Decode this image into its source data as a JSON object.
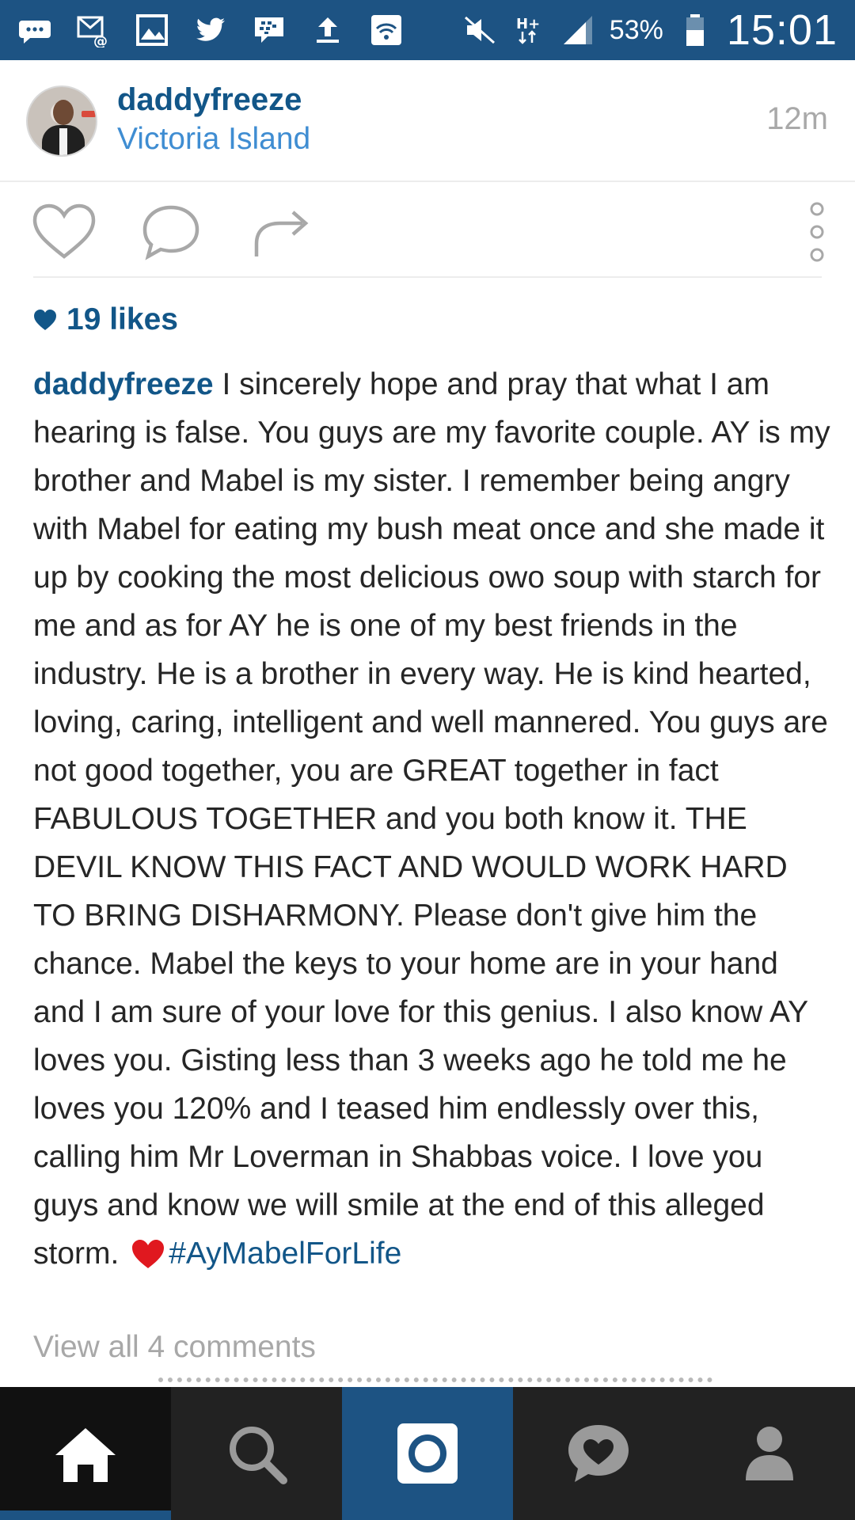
{
  "status_bar": {
    "battery_percent": "53%",
    "time": "15:01",
    "icons": [
      "message-icon",
      "email-icon",
      "gallery-icon",
      "twitter-icon",
      "bbm-icon",
      "upload-icon",
      "wifi-icon",
      "mute-icon",
      "network-hplus-icon",
      "signal-icon",
      "battery-icon"
    ]
  },
  "post": {
    "username": "daddyfreeze",
    "location": "Victoria Island",
    "time_ago": "12m",
    "likes": "19 likes",
    "caption": {
      "username": "daddyfreeze",
      "text": "I sincerely hope and pray that what I am hearing is false. You guys are my favorite couple. AY is my brother and Mabel is my sister. I remember being angry with Mabel for eating my bush meat once and she made it up by cooking the most delicious owo soup with starch for me and as for AY he is one of my best friends in the industry. He is a brother in every way. He is kind hearted, loving, caring, intelligent and well mannered. You guys are not good together, you are GREAT together in fact FABULOUS TOGETHER and you both know it. THE DEVIL KNOW THIS FACT AND WOULD WORK HARD TO BRING DISHARMONY. Please don't give him the chance. Mabel the keys to your home are in your hand and I am sure of your love for this genius. I also know AY loves you. Gisting less than 3 weeks ago he told me he loves you 120% and I teased him endlessly over this, calling him Mr Loverman in Shabbas voice. I love you guys and know we will smile at the end of this alleged storm.",
      "hashtag": "#AyMabelForLife"
    },
    "view_comments": "View all 4 comments"
  },
  "actions": [
    "like-icon",
    "comment-icon",
    "share-icon",
    "more-options-icon"
  ],
  "bottom_nav": [
    "home-icon",
    "search-icon",
    "camera-icon",
    "activity-icon",
    "profile-icon"
  ],
  "colors": {
    "status_bar": "#1d5383",
    "link_blue": "#125688",
    "location_blue": "#3f8dd2",
    "heart_red": "#e0181f"
  }
}
